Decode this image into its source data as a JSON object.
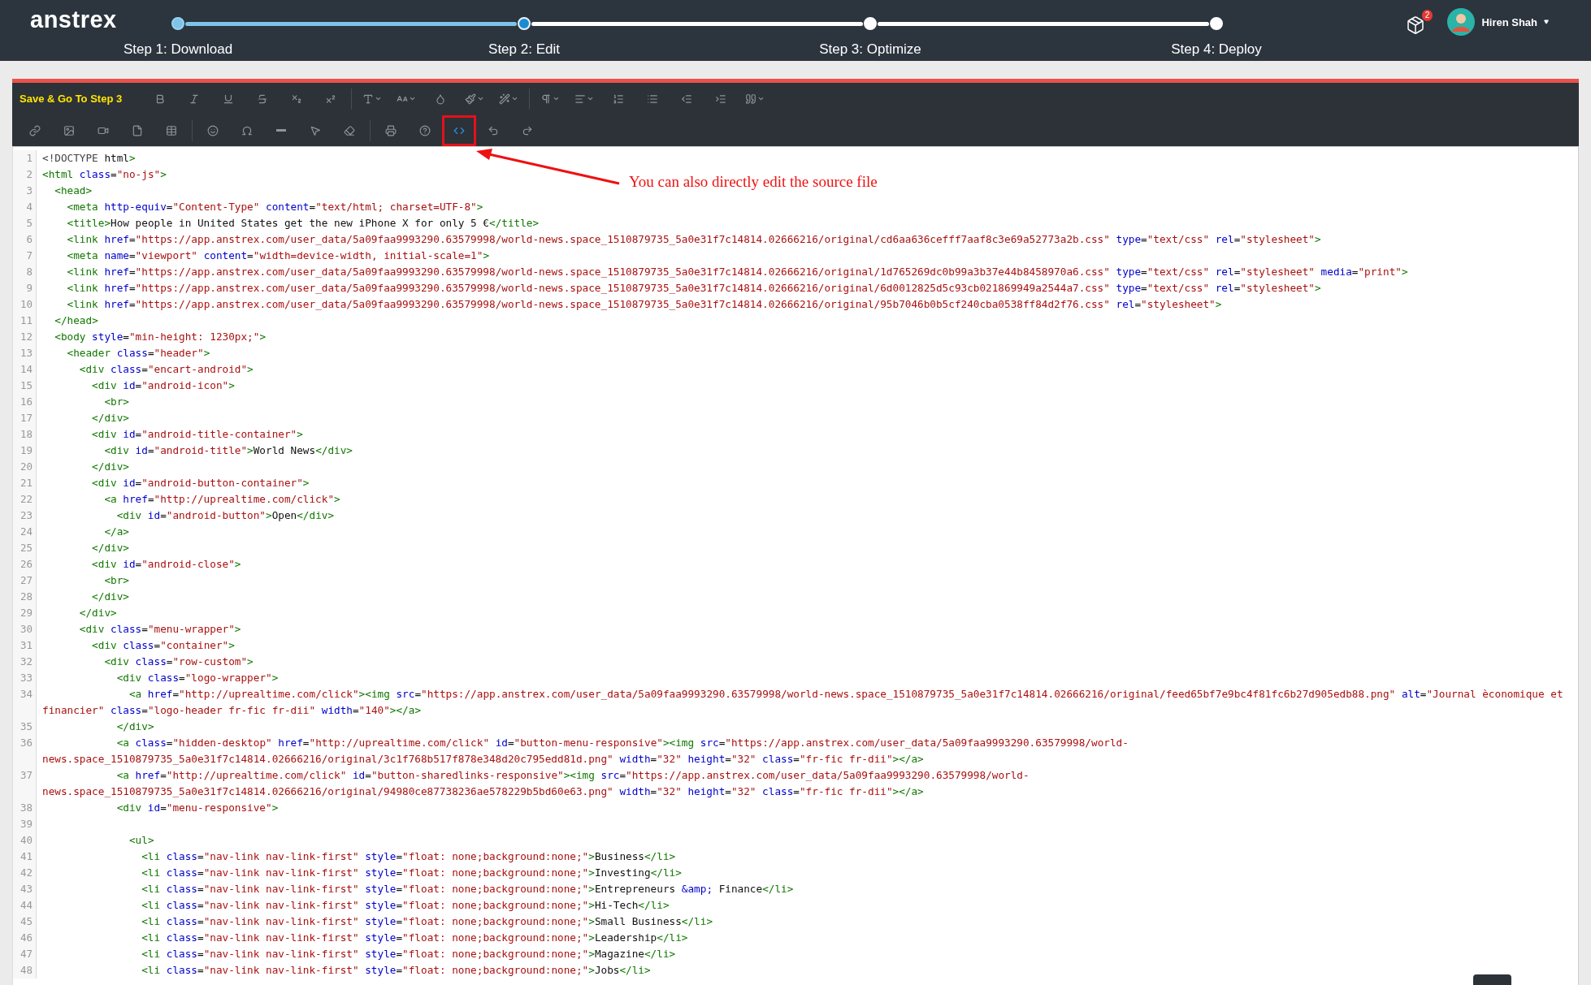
{
  "app": {
    "logo": "anstrex"
  },
  "steps": [
    {
      "label": "Step 1: Download",
      "selected": false
    },
    {
      "label": "Step 2: Edit",
      "selected": true
    },
    {
      "label": "Step 3: Optimize",
      "selected": false
    },
    {
      "label": "Step 4: Deploy",
      "selected": false
    }
  ],
  "notifications": {
    "count": "2"
  },
  "user": {
    "name": "Hiren Shah"
  },
  "toolbar": {
    "save_button": "Save & Go To Step 3",
    "rows": [
      [
        [
          {
            "kind": "bold",
            "dropdown": false,
            "selected": false,
            "highlighted": false
          },
          {
            "kind": "italic",
            "dropdown": false,
            "selected": false,
            "highlighted": false
          },
          {
            "kind": "underline",
            "dropdown": false,
            "selected": false,
            "highlighted": false
          },
          {
            "kind": "strikethrough",
            "dropdown": false,
            "selected": false,
            "highlighted": false
          },
          {
            "kind": "subscript",
            "dropdown": false,
            "selected": false,
            "highlighted": false
          },
          {
            "kind": "superscript",
            "dropdown": false,
            "selected": false,
            "highlighted": false
          }
        ],
        [
          {
            "kind": "font-family",
            "dropdown": true,
            "selected": false,
            "highlighted": false
          },
          {
            "kind": "font-size",
            "dropdown": true,
            "selected": false,
            "highlighted": false
          },
          {
            "kind": "color",
            "dropdown": false,
            "selected": false,
            "highlighted": false
          },
          {
            "kind": "paint",
            "dropdown": true,
            "selected": false,
            "highlighted": false
          },
          {
            "kind": "style",
            "dropdown": true,
            "selected": false,
            "highlighted": false
          }
        ],
        [
          {
            "kind": "paragraph",
            "dropdown": true,
            "selected": false,
            "highlighted": false
          },
          {
            "kind": "align",
            "dropdown": true,
            "selected": false,
            "highlighted": false
          },
          {
            "kind": "ordered-list",
            "dropdown": false,
            "selected": false,
            "highlighted": false
          },
          {
            "kind": "bullet-list",
            "dropdown": false,
            "selected": false,
            "highlighted": false
          },
          {
            "kind": "outdent",
            "dropdown": false,
            "selected": false,
            "highlighted": false
          },
          {
            "kind": "indent",
            "dropdown": false,
            "selected": false,
            "highlighted": false
          },
          {
            "kind": "quote",
            "dropdown": true,
            "selected": false,
            "highlighted": false
          }
        ]
      ],
      [
        [
          {
            "kind": "link",
            "dropdown": false,
            "selected": false,
            "highlighted": false
          },
          {
            "kind": "image",
            "dropdown": false,
            "selected": false,
            "highlighted": false
          },
          {
            "kind": "video",
            "dropdown": false,
            "selected": false,
            "highlighted": false
          },
          {
            "kind": "file",
            "dropdown": false,
            "selected": false,
            "highlighted": false
          },
          {
            "kind": "table",
            "dropdown": false,
            "selected": false,
            "highlighted": false
          }
        ],
        [
          {
            "kind": "emoji",
            "dropdown": false,
            "selected": false,
            "highlighted": false
          },
          {
            "kind": "symbol",
            "dropdown": false,
            "selected": false,
            "highlighted": false
          },
          {
            "kind": "rule",
            "dropdown": false,
            "selected": false,
            "highlighted": false
          },
          {
            "kind": "select",
            "dropdown": false,
            "selected": false,
            "highlighted": false
          },
          {
            "kind": "clear",
            "dropdown": false,
            "selected": false,
            "highlighted": false
          }
        ],
        [
          {
            "kind": "print",
            "dropdown": false,
            "selected": false,
            "highlighted": false
          },
          {
            "kind": "help",
            "dropdown": false,
            "selected": false,
            "highlighted": false
          },
          {
            "kind": "code",
            "dropdown": false,
            "selected": true,
            "highlighted": true
          },
          {
            "kind": "undo",
            "dropdown": false,
            "selected": false,
            "highlighted": false
          },
          {
            "kind": "redo",
            "dropdown": false,
            "selected": false,
            "highlighted": false
          }
        ]
      ]
    ]
  },
  "annotation": {
    "text": "You can also directly edit the source file"
  },
  "code": [
    {
      "n": "1",
      "text": "<!DOCTYPE html>"
    },
    {
      "n": "2",
      "text": "<html class=\"no-js\">"
    },
    {
      "n": "3",
      "text": "  <head>"
    },
    {
      "n": "4",
      "text": "    <meta http-equiv=\"Content-Type\" content=\"text/html; charset=UTF-8\">"
    },
    {
      "n": "5",
      "text": "    <title>How people in United States get the new iPhone X for only 5 €</title>"
    },
    {
      "n": "6",
      "text": "    <link href=\"https://app.anstrex.com/user_data/5a09faa9993290.63579998/world-news.space_1510879735_5a0e31f7c14814.02666216/original/cd6aa636cefff7aaf8c3e69a52773a2b.css\" type=\"text/css\" rel=\"stylesheet\">"
    },
    {
      "n": "7",
      "text": "    <meta name=\"viewport\" content=\"width=device-width, initial-scale=1\">"
    },
    {
      "n": "8",
      "text": "    <link href=\"https://app.anstrex.com/user_data/5a09faa9993290.63579998/world-news.space_1510879735_5a0e31f7c14814.02666216/original/1d765269dc0b99a3b37e44b8458970a6.css\" type=\"text/css\" rel=\"stylesheet\" media=\"print\">"
    },
    {
      "n": "9",
      "text": "    <link href=\"https://app.anstrex.com/user_data/5a09faa9993290.63579998/world-news.space_1510879735_5a0e31f7c14814.02666216/original/6d0012825d5c93cb021869949a2544a7.css\" type=\"text/css\" rel=\"stylesheet\">"
    },
    {
      "n": "10",
      "text": "    <link href=\"https://app.anstrex.com/user_data/5a09faa9993290.63579998/world-news.space_1510879735_5a0e31f7c14814.02666216/original/95b7046b0b5cf240cba0538ff84d2f76.css\" rel=\"stylesheet\">"
    },
    {
      "n": "11",
      "text": "  </head>"
    },
    {
      "n": "12",
      "text": "  <body style=\"min-height: 1230px;\">"
    },
    {
      "n": "13",
      "text": "    <header class=\"header\">"
    },
    {
      "n": "14",
      "text": "      <div class=\"encart-android\">"
    },
    {
      "n": "15",
      "text": "        <div id=\"android-icon\">"
    },
    {
      "n": "16",
      "text": "          <br>"
    },
    {
      "n": "17",
      "text": "        </div>"
    },
    {
      "n": "18",
      "text": "        <div id=\"android-title-container\">"
    },
    {
      "n": "19",
      "text": "          <div id=\"android-title\">World News</div>"
    },
    {
      "n": "20",
      "text": "        </div>"
    },
    {
      "n": "21",
      "text": "        <div id=\"android-button-container\">"
    },
    {
      "n": "22",
      "text": "          <a href=\"http://uprealtime.com/click\">"
    },
    {
      "n": "23",
      "text": "            <div id=\"android-button\">Open</div>"
    },
    {
      "n": "24",
      "text": "          </a>"
    },
    {
      "n": "25",
      "text": "        </div>"
    },
    {
      "n": "26",
      "text": "        <div id=\"android-close\">"
    },
    {
      "n": "27",
      "text": "          <br>"
    },
    {
      "n": "28",
      "text": "        </div>"
    },
    {
      "n": "29",
      "text": "      </div>"
    },
    {
      "n": "30",
      "text": "      <div class=\"menu-wrapper\">"
    },
    {
      "n": "31",
      "text": "        <div class=\"container\">"
    },
    {
      "n": "32",
      "text": "          <div class=\"row-custom\">"
    },
    {
      "n": "33",
      "text": "            <div class=\"logo-wrapper\">"
    },
    {
      "n": "34",
      "text": "              <a href=\"http://uprealtime.com/click\"><img src=\"https://app.anstrex.com/user_data/5a09faa9993290.63579998/world-news.space_1510879735_5a0e31f7c14814.02666216/original/feed65bf7e9bc4f81fc6b27d905edb88.png\" alt=\"Journal èconomique et financier\" class=\"logo-header fr-fic fr-dii\" width=\"140\"></a>"
    },
    {
      "n": "35",
      "text": "            </div>"
    },
    {
      "n": "36",
      "text": "            <a class=\"hidden-desktop\" href=\"http://uprealtime.com/click\" id=\"button-menu-responsive\"><img src=\"https://app.anstrex.com/user_data/5a09faa9993290.63579998/world-news.space_1510879735_5a0e31f7c14814.02666216/original/3c1f768b517f878e348d20c795edd81d.png\" width=\"32\" height=\"32\" class=\"fr-fic fr-dii\"></a>"
    },
    {
      "n": "37",
      "text": "            <a href=\"http://uprealtime.com/click\" id=\"button-sharedlinks-responsive\"><img src=\"https://app.anstrex.com/user_data/5a09faa9993290.63579998/world-news.space_1510879735_5a0e31f7c14814.02666216/original/94980ce87738236ae578229b5bd60e63.png\" width=\"32\" height=\"32\" class=\"fr-fic fr-dii\"></a>"
    },
    {
      "n": "38",
      "text": "            <div id=\"menu-responsive\">"
    },
    {
      "n": "39"
    },
    {
      "n": "40",
      "text": "              <ul>"
    },
    {
      "n": "41",
      "text": "                <li class=\"nav-link nav-link-first\" style=\"float: none;background:none;\">Business</li>"
    },
    {
      "n": "42",
      "text": "                <li class=\"nav-link nav-link-first\" style=\"float: none;background:none;\">Investing</li>"
    },
    {
      "n": "43",
      "text": "                <li class=\"nav-link nav-link-first\" style=\"float: none;background:none;\">Entrepreneurs &amp; Finance</li>"
    },
    {
      "n": "44",
      "text": "                <li class=\"nav-link nav-link-first\" style=\"float: none;background:none;\">Hi-Tech</li>"
    },
    {
      "n": "45",
      "text": "                <li class=\"nav-link nav-link-first\" style=\"float: none;background:none;\">Small Business</li>"
    },
    {
      "n": "46",
      "text": "                <li class=\"nav-link nav-link-first\" style=\"float: none;background:none;\">Leadership</li>"
    },
    {
      "n": "47",
      "text": "                <li class=\"nav-link nav-link-first\" style=\"float: none;background:none;\">Magazine</li>"
    },
    {
      "n": "48",
      "text": "                <li class=\"nav-link nav-link-first\" style=\"float: none;background:none;\">Jobs</li>"
    }
  ]
}
